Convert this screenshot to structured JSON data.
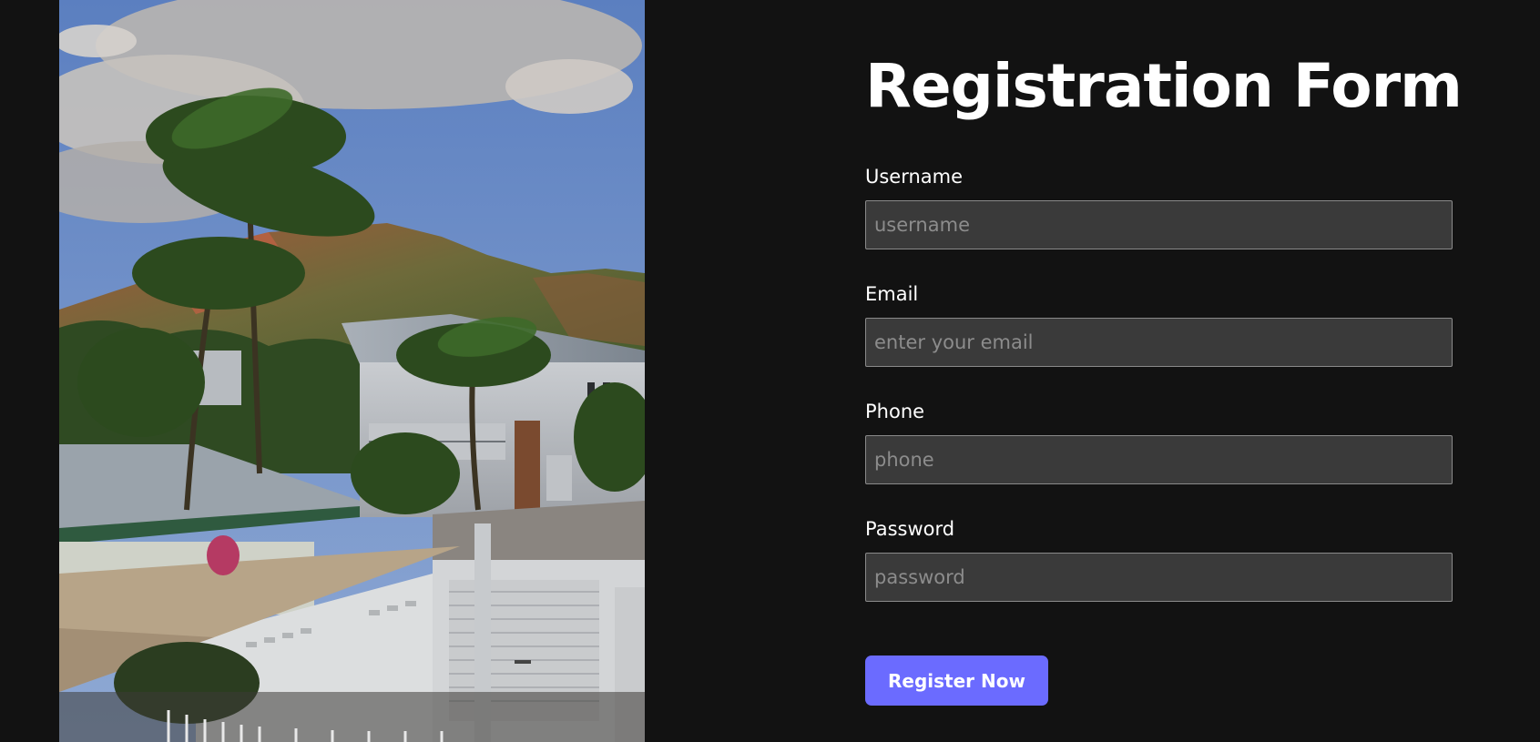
{
  "form": {
    "title": "Registration Form",
    "fields": [
      {
        "label": "Username",
        "placeholder": "username",
        "value": ""
      },
      {
        "label": "Email",
        "placeholder": "enter your email",
        "value": ""
      },
      {
        "label": "Phone",
        "placeholder": "phone",
        "value": ""
      },
      {
        "label": "Password",
        "placeholder": "password",
        "value": ""
      }
    ],
    "submit_label": "Register Now"
  },
  "colors": {
    "background": "#121212",
    "input_background": "#3a3a3a",
    "input_border": "#8a8a8a",
    "placeholder": "#8c8c8c",
    "accent": "#6b6bff",
    "text": "#ffffff"
  }
}
